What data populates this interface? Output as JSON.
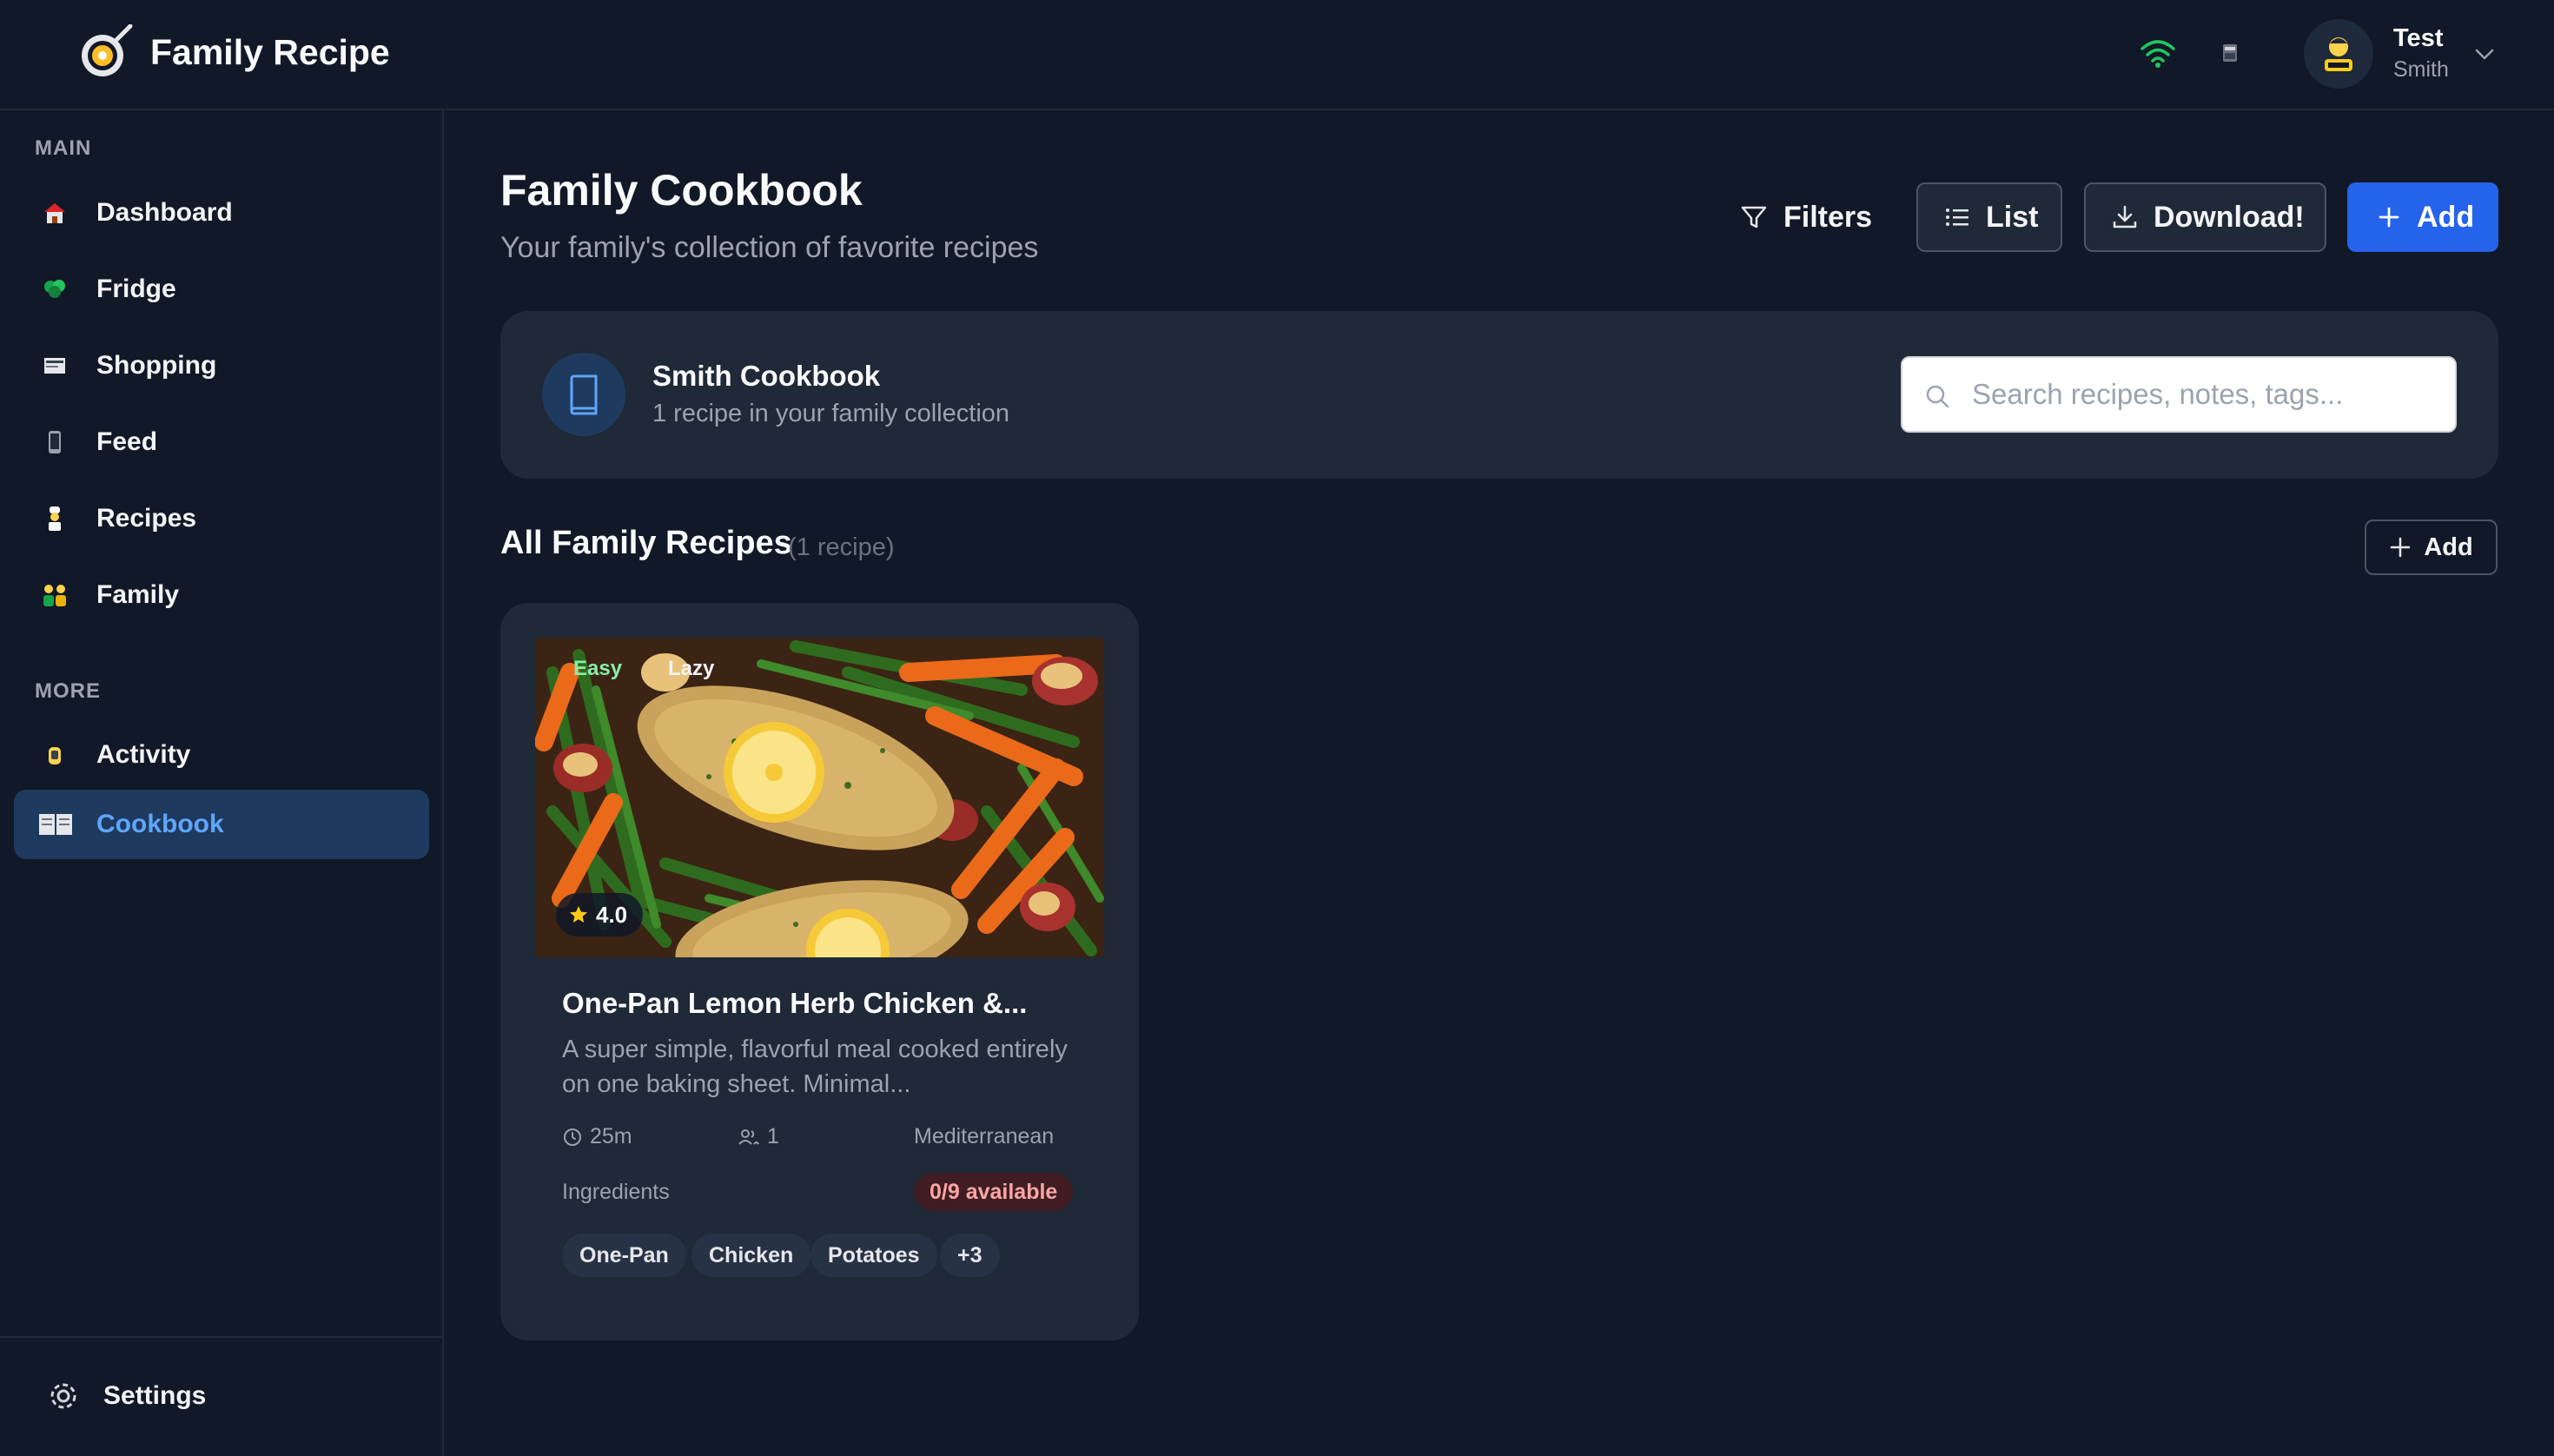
{
  "header": {
    "app_title": "Family Recipe",
    "user": {
      "first_name": "Test",
      "last_name": "Smith"
    }
  },
  "sidebar": {
    "main_label": "MAIN",
    "main_items": [
      {
        "label": "Dashboard",
        "icon": "house-icon"
      },
      {
        "label": "Fridge",
        "icon": "broccoli-icon"
      },
      {
        "label": "Shopping",
        "icon": "receipt-icon"
      },
      {
        "label": "Feed",
        "icon": "phone-icon"
      },
      {
        "label": "Recipes",
        "icon": "chef-icon"
      },
      {
        "label": "Family",
        "icon": "family-icon"
      }
    ],
    "more_label": "MORE",
    "more_items": [
      {
        "label": "Activity",
        "icon": "hand-icon"
      },
      {
        "label": "Cookbook",
        "icon": "open-book-icon",
        "active": true
      }
    ],
    "settings_label": "Settings"
  },
  "page": {
    "title": "Family Cookbook",
    "subtitle": "Your family's collection of favorite recipes",
    "buttons": {
      "filters": "Filters",
      "list": "List",
      "download": "Download!",
      "add": "Add"
    }
  },
  "cookbook": {
    "name": "Smith Cookbook",
    "summary": "1 recipe in your family collection",
    "search_placeholder": "Search recipes, notes, tags..."
  },
  "recipes_section": {
    "heading": "All Family Recipes",
    "count": "(1 recipe)",
    "add_label": "Add"
  },
  "recipes": [
    {
      "tags_on_image": [
        "Easy",
        "Lazy"
      ],
      "rating": "4.0",
      "title": "One-Pan Lemon Herb Chicken &...",
      "description": "A super simple, flavorful meal cooked entirely on one baking sheet. Minimal...",
      "time": "25m",
      "servings": "1",
      "cuisine": "Mediterranean",
      "ingredients_label": "Ingredients",
      "availability": "0/9 available",
      "chips": [
        "One-Pan",
        "Chicken",
        "Potatoes",
        "+3"
      ]
    }
  ],
  "colors": {
    "background": "#111827",
    "card": "#1f2937",
    "accent": "#2563eb",
    "active_nav": "#1e3a5f",
    "active_text": "#60a5fa",
    "warning_text": "#fca5a5"
  }
}
